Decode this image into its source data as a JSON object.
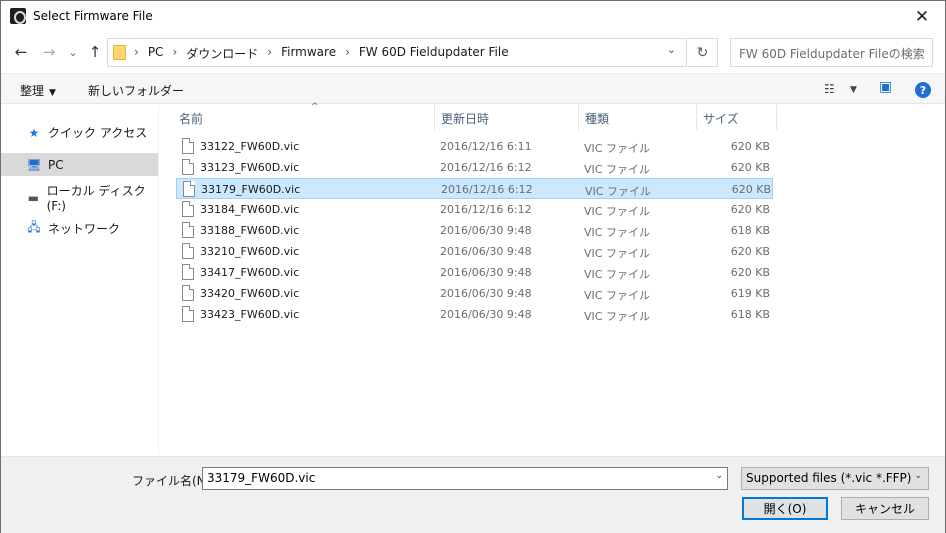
{
  "window": {
    "title": "Select Firmware File",
    "close_glyph": "✕"
  },
  "nav": {
    "back_glyph": "←",
    "forward_glyph": "→",
    "recent_glyph": "⌄",
    "up_glyph": "↑",
    "breadcrumb": [
      "PC",
      "ダウンロード",
      "Firmware",
      "FW 60D Fieldupdater File"
    ],
    "breadcrumb_sep": "›",
    "address_dropdown_glyph": "⌄",
    "refresh_glyph": "↻",
    "search_placeholder": "FW 60D Fieldupdater Fileの検索"
  },
  "commands": {
    "organize": "整理",
    "organize_dd": "▼",
    "new_folder": "新しいフォルダー",
    "view_glyph": "☷",
    "view_dd": "▼",
    "preview_glyph": "▣",
    "help_glyph": "?"
  },
  "sidebar": {
    "items": [
      {
        "label": "クイック アクセス",
        "icon": "star-icon",
        "glyph": "★",
        "color": "#1e78d7"
      },
      {
        "label": "PC",
        "icon": "computer-icon",
        "glyph": "🖥",
        "color": "#1e6fd0"
      },
      {
        "label": "ローカル ディスク (F:)",
        "icon": "drive-icon",
        "glyph": "▬",
        "color": "#555555"
      },
      {
        "label": "ネットワーク",
        "icon": "network-icon",
        "glyph": "🖧",
        "color": "#1e6fd0"
      }
    ]
  },
  "columns": {
    "name": "名前",
    "date": "更新日時",
    "type": "種類",
    "size": "サイズ",
    "sort_glyph": "^"
  },
  "files": [
    {
      "name": "33122_FW60D.vic",
      "date": "2016/12/16 6:11",
      "type": "VIC ファイル",
      "size": "620 KB",
      "selected": false
    },
    {
      "name": "33123_FW60D.vic",
      "date": "2016/12/16 6:12",
      "type": "VIC ファイル",
      "size": "620 KB",
      "selected": false
    },
    {
      "name": "33179_FW60D.vic",
      "date": "2016/12/16 6:12",
      "type": "VIC ファイル",
      "size": "620 KB",
      "selected": true
    },
    {
      "name": "33184_FW60D.vic",
      "date": "2016/12/16 6:12",
      "type": "VIC ファイル",
      "size": "620 KB",
      "selected": false
    },
    {
      "name": "33188_FW60D.vic",
      "date": "2016/06/30 9:48",
      "type": "VIC ファイル",
      "size": "618 KB",
      "selected": false
    },
    {
      "name": "33210_FW60D.vic",
      "date": "2016/06/30 9:48",
      "type": "VIC ファイル",
      "size": "620 KB",
      "selected": false
    },
    {
      "name": "33417_FW60D.vic",
      "date": "2016/06/30 9:48",
      "type": "VIC ファイル",
      "size": "620 KB",
      "selected": false
    },
    {
      "name": "33420_FW60D.vic",
      "date": "2016/06/30 9:48",
      "type": "VIC ファイル",
      "size": "619 KB",
      "selected": false
    },
    {
      "name": "33423_FW60D.vic",
      "date": "2016/06/30 9:48",
      "type": "VIC ファイル",
      "size": "618 KB",
      "selected": false
    }
  ],
  "footer": {
    "filename_label": "ファイル名(N):",
    "filename_value": "33179_FW60D.vic",
    "filename_dd": "⌄",
    "filetype_value": "Supported files (*.vic *.FFP)",
    "filetype_dd": "⌄",
    "open_label": "開く(O)",
    "cancel_label": "キャンセル"
  }
}
